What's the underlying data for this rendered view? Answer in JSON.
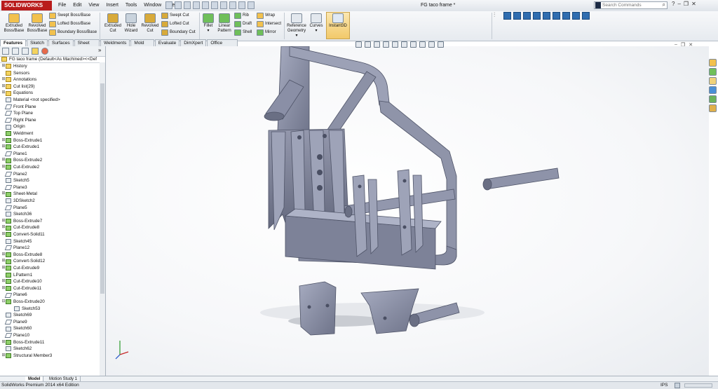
{
  "app": {
    "logo": "SOLIDWORKS",
    "document_title": "FG taco frame *"
  },
  "menu": [
    "File",
    "Edit",
    "View",
    "Insert",
    "Tools",
    "Window",
    "Help"
  ],
  "search": {
    "placeholder": "Search Commands"
  },
  "ribbon": {
    "extruded_boss": "Extruded Boss/Base",
    "revolved_boss": "Revolved Boss/Base",
    "swept_boss": "Swept Boss/Base",
    "lofted_boss": "Lofted Boss/Base",
    "boundary_boss": "Boundary Boss/Base",
    "extruded_cut": "Extruded Cut",
    "hole_wizard": "Hole Wizard",
    "revolved_cut": "Revolved Cut",
    "swept_cut": "Swept Cut",
    "lofted_cut": "Lofted Cut",
    "boundary_cut": "Boundary Cut",
    "fillet": "Fillet",
    "linear_pattern": "Linear Pattern",
    "rib": "Rib",
    "draft": "Draft",
    "shell": "Shell",
    "wrap": "Wrap",
    "intersect": "Intersect",
    "mirror": "Mirror",
    "reference_geometry": "Reference Geometry",
    "curves": "Curves",
    "instant3d": "Instant3D"
  },
  "command_tabs": [
    "Features",
    "Sketch",
    "Surfaces",
    "Sheet Metal",
    "Weldments",
    "Mold Tools",
    "Evaluate",
    "DimXpert",
    "Office Products"
  ],
  "tree_root": "FG taco frame  (Default<As Machined><<Def",
  "tree": [
    {
      "label": "History",
      "icon": "folder",
      "expand": "+"
    },
    {
      "label": "Sensors",
      "icon": "folder",
      "expand": ""
    },
    {
      "label": "Annotations",
      "icon": "folder",
      "expand": "+"
    },
    {
      "label": "Cut list(29)",
      "icon": "folder",
      "expand": "+"
    },
    {
      "label": "Equations",
      "icon": "folder",
      "expand": "+"
    },
    {
      "label": "Material <not specified>",
      "icon": "material",
      "expand": ""
    },
    {
      "label": "Front Plane",
      "icon": "plane",
      "expand": ""
    },
    {
      "label": "Top Plane",
      "icon": "plane",
      "expand": ""
    },
    {
      "label": "Right Plane",
      "icon": "plane",
      "expand": ""
    },
    {
      "label": "Origin",
      "icon": "origin",
      "expand": ""
    },
    {
      "label": "Weldment",
      "icon": "weldment",
      "expand": ""
    },
    {
      "label": "Boss-Extrude1",
      "icon": "feature",
      "expand": "+"
    },
    {
      "label": "Cut-Extrude1",
      "icon": "feature",
      "expand": "+"
    },
    {
      "label": "Plane1",
      "icon": "plane",
      "expand": ""
    },
    {
      "label": "Boss-Extrude2",
      "icon": "feature",
      "expand": "+"
    },
    {
      "label": "Cut-Extrude2",
      "icon": "feature",
      "expand": "+"
    },
    {
      "label": "Plane2",
      "icon": "plane",
      "expand": ""
    },
    {
      "label": "Sketch5",
      "icon": "sketch",
      "expand": ""
    },
    {
      "label": "Plane3",
      "icon": "plane",
      "expand": ""
    },
    {
      "label": "Sheet-Metal",
      "icon": "feature",
      "expand": "+"
    },
    {
      "label": "3DSketch2",
      "icon": "sketch",
      "expand": ""
    },
    {
      "label": "Plane5",
      "icon": "plane",
      "expand": ""
    },
    {
      "label": "Sketch36",
      "icon": "sketch",
      "expand": ""
    },
    {
      "label": "Boss-Extrude7",
      "icon": "feature",
      "expand": "+"
    },
    {
      "label": "Cut-Extrude8",
      "icon": "feature",
      "expand": "+"
    },
    {
      "label": "Convert-Solid11",
      "icon": "feature",
      "expand": "+"
    },
    {
      "label": "Sketch45",
      "icon": "sketch",
      "expand": ""
    },
    {
      "label": "Plane12",
      "icon": "plane",
      "expand": ""
    },
    {
      "label": "Boss-Extrude8",
      "icon": "feature",
      "expand": "+"
    },
    {
      "label": "Convert-Solid12",
      "icon": "feature",
      "expand": "+"
    },
    {
      "label": "Cut-Extrude9",
      "icon": "feature",
      "expand": "+"
    },
    {
      "label": "LPattern1",
      "icon": "feature",
      "expand": ""
    },
    {
      "label": "Cut-Extrude10",
      "icon": "feature",
      "expand": "+"
    },
    {
      "label": "Cut-Extrude11",
      "icon": "feature",
      "expand": "+"
    },
    {
      "label": "Plane6",
      "icon": "plane",
      "expand": ""
    },
    {
      "label": "Boss-Extrude20",
      "icon": "feature",
      "expand": "-"
    },
    {
      "label": "Sketch53",
      "icon": "sketch",
      "expand": "",
      "indent": 1
    },
    {
      "label": "Sketch69",
      "icon": "sketch",
      "expand": ""
    },
    {
      "label": "Plane9",
      "icon": "plane",
      "expand": ""
    },
    {
      "label": "Sketch60",
      "icon": "sketch",
      "expand": ""
    },
    {
      "label": "Plane10",
      "icon": "plane",
      "expand": ""
    },
    {
      "label": "Boss-Extrude11",
      "icon": "feature",
      "expand": "+"
    },
    {
      "label": "Sketch62",
      "icon": "sketch",
      "expand": ""
    },
    {
      "label": "Structural Member3",
      "icon": "feature",
      "expand": "+"
    }
  ],
  "bottom_tabs": [
    "Model",
    "Motion Study 1"
  ],
  "status": {
    "left": "SolidWorks Premium 2014 x64 Edition",
    "units": "IPS"
  },
  "colors": {
    "model_fill": "#8a8fa6",
    "model_dark": "#5d6277",
    "model_light": "#a8adc2",
    "accent_red": "#b91c1c"
  }
}
